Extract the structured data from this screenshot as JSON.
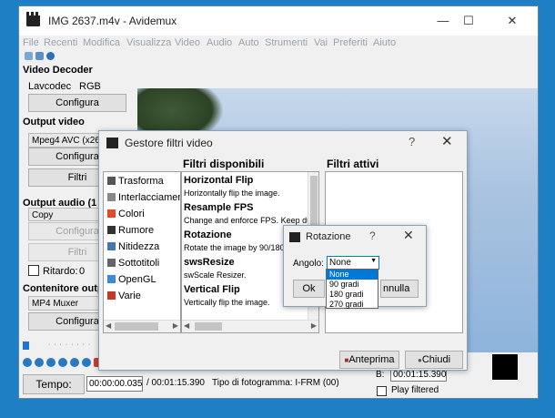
{
  "window": {
    "title": "IMG 2637.m4v - Avidemux",
    "minimize": "—",
    "maximize": "☐",
    "close": "✕"
  },
  "menu": [
    "File",
    "Recenti",
    "Modifica",
    "Visualizza",
    "Video",
    "Audio",
    "Auto",
    "Strumenti",
    "Vai",
    "Preferiti",
    "Aiuto"
  ],
  "left_panel": {
    "video_decoder": {
      "title": "Video Decoder",
      "lavcodec": "Lavcodec",
      "rgb": "RGB",
      "config_btn": "Configura"
    },
    "output_video": {
      "title": "Output video",
      "codec": "Mpeg4 AVC (x264)",
      "config_btn": "Configura",
      "filters_btn": "Filtri"
    },
    "output_audio": {
      "title": "Output audio (1 tr",
      "codec": "Copy",
      "config_btn": "Configura",
      "filters_btn": "Filtri",
      "delay_label": "Ritardo:",
      "delay_value": "0"
    },
    "container": {
      "title": "Contenitore outpu",
      "format": "MP4 Muxer",
      "config_btn": "Configura"
    }
  },
  "status": {
    "tempo_label": "Tempo:",
    "current_time": "00:00:00.035",
    "total_time": "/ 00:01:15.390",
    "frame_type": "Tipo di fotogramma: I-FRM (00)",
    "b_label": "B:",
    "b_value": "00:01:15.390",
    "play_filtered": "Play filtered"
  },
  "filters_dialog": {
    "title": "Gestore filtri video",
    "help": "?",
    "close": "✕",
    "available_header": "Filtri disponibili",
    "active_header": "Filtri attivi",
    "categories": [
      {
        "label": "Trasforma",
        "color": "#555555"
      },
      {
        "label": "Interlacciamen",
        "color": "#888888"
      },
      {
        "label": "Colori",
        "color": "#e04b2a"
      },
      {
        "label": "Rumore",
        "color": "#333333"
      },
      {
        "label": "Nitidezza",
        "color": "#4477aa"
      },
      {
        "label": "Sottotitoli",
        "color": "#666666"
      },
      {
        "label": "OpenGL",
        "color": "#3a8ad6"
      },
      {
        "label": "Varie",
        "color": "#c0392b"
      }
    ],
    "filters": [
      {
        "name": "Horizontal Flip",
        "desc": "Horizontally flip the image."
      },
      {
        "name": "Resample FPS",
        "desc": "Change and enforce FPS. Keep dura"
      },
      {
        "name": "Rotazione",
        "desc": "Rotate the image by 90/180/27"
      },
      {
        "name": "swsResize",
        "desc": "swScale Resizer."
      },
      {
        "name": "Vertical Flip",
        "desc": "Vertically flip the image."
      }
    ],
    "preview_btn": "Anteprima",
    "close_btn": "Chiudi"
  },
  "rotation_dialog": {
    "title": "Rotazione",
    "help": "?",
    "close": "✕",
    "angle_label": "Angolo:",
    "selected": "None",
    "options": [
      "None",
      "90 gradi",
      "180 gradi",
      "270 gradi"
    ],
    "ok_partial": "Ok",
    "cancel_partial": "nnulla"
  }
}
